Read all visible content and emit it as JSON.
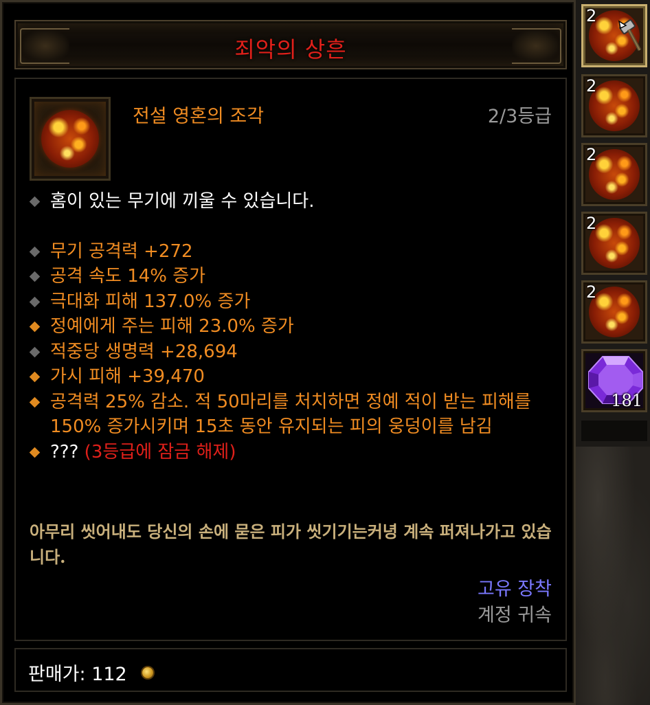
{
  "tooltip": {
    "title": "죄악의 상흔",
    "gem_name": "전설 영혼의 조각",
    "gem_rank": "2/3등급",
    "socket_text": "홈이 있는 무기에 끼울 수 있습니다.",
    "properties": [
      {
        "text": "무기 공격력 +272",
        "marker": "gray"
      },
      {
        "text": "공격 속도 14% 증가",
        "marker": "gray"
      },
      {
        "text": "극대화 피해 137.0% 증가",
        "marker": "gray"
      },
      {
        "text": "정예에게 주는 피해 23.0% 증가",
        "marker": "orange"
      },
      {
        "text": "적중당 생명력 +28,694",
        "marker": "gray"
      },
      {
        "text": "가시 피해 +39,470",
        "marker": "orange"
      },
      {
        "text": "공격력 25% 감소. 적 50마리를 처치하면 정예 적이 받는 피해를 150% 증가시키며 15초 동안 유지되는 피의 웅덩이를 남김",
        "marker": "orange"
      }
    ],
    "locked": {
      "prefix": "???",
      "text": "(3등급에 잠금 해제)"
    },
    "flavor": "아무리 씻어내도 당신의 손에 묻은 피가 씻기기는커녕 계속 퍼져나가고 있습니다.",
    "bind_unique": "고유 장착",
    "bind_account": "계정 귀속",
    "price_label": "판매가: 112",
    "coin_icon": "gold-coin-icon"
  },
  "sidebar": {
    "slots": [
      {
        "rank": "2",
        "icon": "legendary-soul-shard-icon",
        "selected": true
      },
      {
        "rank": "2",
        "icon": "legendary-soul-shard-icon"
      },
      {
        "rank": "2",
        "icon": "legendary-soul-shard-icon"
      },
      {
        "rank": "2",
        "icon": "legendary-soul-shard-icon"
      },
      {
        "rank": "2",
        "icon": "legendary-soul-shard-icon"
      }
    ],
    "amethyst_count": "181"
  },
  "colors": {
    "title": "#e0201a",
    "legendary": "#f08c22",
    "flavor": "#c9b07c",
    "bind_unique": "#7a78ff",
    "gray": "#9a9a9a"
  }
}
